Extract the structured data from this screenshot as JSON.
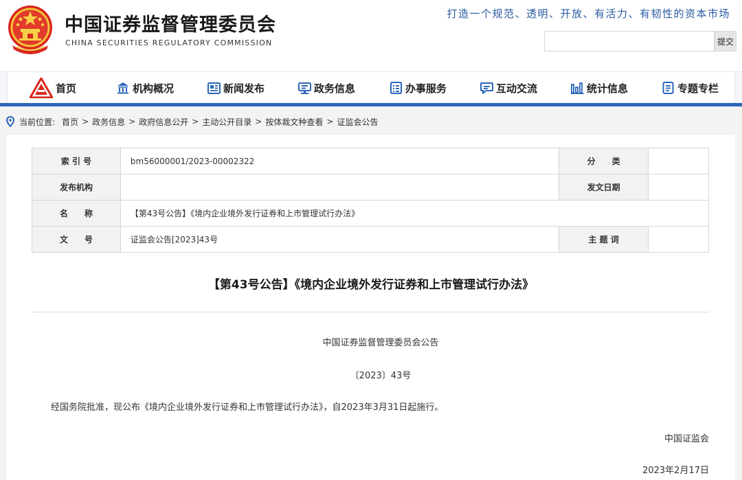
{
  "header": {
    "title": "中国证券监督管理委员会",
    "subtitle": "CHINA SECURITIES REGULATORY COMMISSION",
    "slogan": "打造一个规范、透明、开放、有活力、有韧性的资本市场",
    "search": {
      "placeholder": "",
      "value": "",
      "button_label": "提交"
    }
  },
  "nav": {
    "items": [
      {
        "label": "首页",
        "icon": "csrc-logo-icon"
      },
      {
        "label": "机构概况",
        "icon": "building-icon"
      },
      {
        "label": "新闻发布",
        "icon": "newspaper-icon"
      },
      {
        "label": "政务信息",
        "icon": "monitor-icon"
      },
      {
        "label": "办事服务",
        "icon": "clipboard-icon"
      },
      {
        "label": "互动交流",
        "icon": "chat-icon"
      },
      {
        "label": "统计信息",
        "icon": "bar-chart-icon"
      },
      {
        "label": "专题专栏",
        "icon": "document-icon"
      }
    ],
    "accent_color": "#2a66b8"
  },
  "breadcrumb": {
    "prefix": "当前位置:",
    "items": [
      "首页",
      "政务信息",
      "政府信息公开",
      "主动公开目录",
      "按体裁文种查看",
      "证监会公告"
    ],
    "separator": ">"
  },
  "meta": {
    "index_label": "索 引 号",
    "index_value": "bm56000001/2023-00002322",
    "category_label": "分　　类",
    "category_value": "",
    "publisher_label": "发布机构",
    "publisher_value": "",
    "date_label": "发文日期",
    "date_value": "",
    "name_label": "名　　称",
    "name_value": "【第43号公告】《境内企业境外发行证券和上市管理试行办法》",
    "docno_label": "文　　号",
    "docno_value": "证监会公告[2023]43号",
    "keyword_label": "主 题 词",
    "keyword_value": ""
  },
  "article": {
    "title": "【第43号公告】《境内企业境外发行证券和上市管理试行办法》",
    "org_line": "中国证券监督管理委员会公告",
    "number_line": "〔2023〕43号",
    "body": "经国务院批准，现公布《境内企业境外发行证券和上市管理试行办法》，自2023年3月31日起施行。",
    "signature": "中国证监会",
    "date": "2023年2月17日"
  }
}
